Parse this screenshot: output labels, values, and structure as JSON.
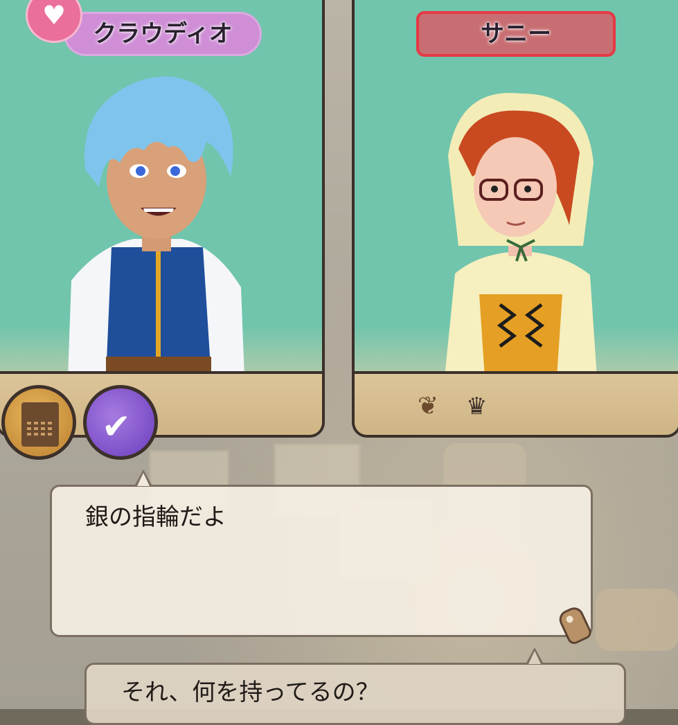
{
  "left_character": {
    "name": "クラウディオ",
    "heart_icon": "heart-icon"
  },
  "right_character": {
    "name": "サニー",
    "bar_icons": [
      "wheat-icon",
      "crown-icon"
    ]
  },
  "action_icons": [
    "gift-board-icon",
    "check-icon"
  ],
  "dialog": {
    "current_line": "銀の指輪だよ",
    "previous_line": "それ、何を持ってるの？"
  },
  "colors": {
    "panel_bg": "#70c5ac",
    "panel_border": "#3c302a",
    "left_tag": "#cf8ed6",
    "right_tag": "#c86e72",
    "right_tag_border": "#e63945"
  }
}
